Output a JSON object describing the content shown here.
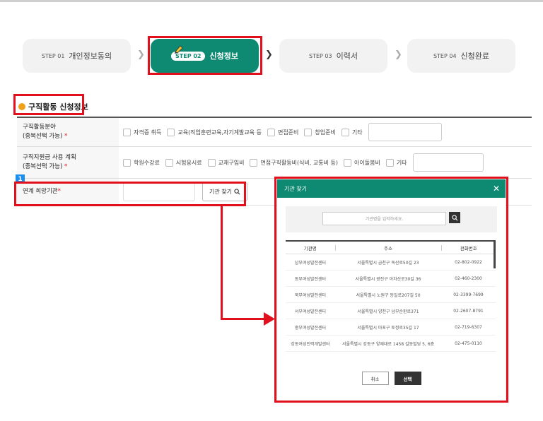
{
  "steps": [
    {
      "num": "STEP 01",
      "label": "개인정보동의"
    },
    {
      "num": "STEP 02",
      "label": "신청정보"
    },
    {
      "num": "STEP 03",
      "label": "이력서"
    },
    {
      "num": "STEP 04",
      "label": "신청완료"
    }
  ],
  "section": {
    "title": "구직활동 신청정보"
  },
  "form": {
    "row1": {
      "label1": "구직활동분야",
      "label2": "(중복선택 가능)",
      "required": "*",
      "options": [
        "자격증 취득",
        "교육(직업훈련교육,자기계발교육 등",
        "면접준비",
        "창업준비",
        "기타"
      ]
    },
    "row2": {
      "label1": "구직지원금 사용 계획",
      "label2": "(중복선택 가능)",
      "required": "*",
      "options": [
        "학원수강료",
        "시험응시료",
        "교재구입비",
        "면접구직활동비(식비, 교통비 등)",
        "아이돌봄비",
        "기타"
      ]
    },
    "row3": {
      "label": "연계 희망기관",
      "required": "*",
      "find_button": "기관 찾기"
    }
  },
  "badge": "1",
  "modal": {
    "title": "기관 찾기",
    "search_placeholder": "기관명을 입력하세요.",
    "columns": [
      "기관명",
      "주소",
      "전화번호"
    ],
    "rows": [
      [
        "남부여성발전센터",
        "서울특별시 금천구 독산로50길 23",
        "02-802-0922"
      ],
      [
        "동부여성발전센터",
        "서울특별시 광진구 아차산로30길 36",
        "02-460-2300"
      ],
      [
        "북부여성발전센터",
        "서울특별시 노원구 동일로207길 50",
        "02-3399-7699"
      ],
      [
        "서부여성발전센터",
        "서울특별시 양천구 남부순환로371",
        "02-2607-8791"
      ],
      [
        "중부여성발전센터",
        "서울특별시 마포구 토정로35길 17",
        "02-719-6307"
      ],
      [
        "강동여성인력개발센터",
        "서울특별시 강동구 양재대로 1458 길동빌딩 5, 6층",
        "02-475-0110"
      ]
    ],
    "cancel": "취소",
    "select": "선택"
  }
}
